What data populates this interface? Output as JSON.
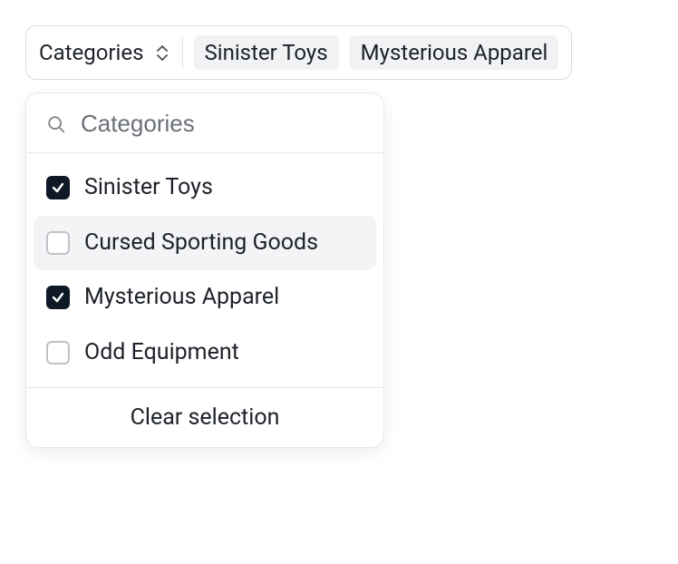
{
  "trigger": {
    "label": "Categories",
    "selected_chips": [
      "Sinister Toys",
      "Mysterious Apparel"
    ]
  },
  "search": {
    "placeholder": "Categories",
    "value": ""
  },
  "options": [
    {
      "label": "Sinister Toys",
      "checked": true,
      "hovered": false
    },
    {
      "label": "Cursed Sporting Goods",
      "checked": false,
      "hovered": true
    },
    {
      "label": "Mysterious Apparel",
      "checked": true,
      "hovered": false
    },
    {
      "label": "Odd Equipment",
      "checked": false,
      "hovered": false
    }
  ],
  "footer": {
    "clear_label": "Clear selection"
  }
}
